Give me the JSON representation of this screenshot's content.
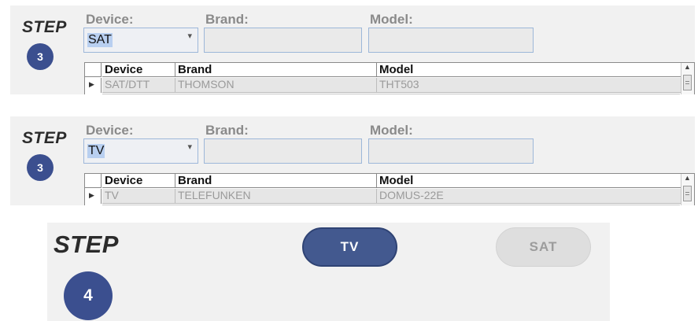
{
  "colors": {
    "step_circle": "#3b4f8f",
    "tv_button": "#43598f",
    "sat_button": "#dedede",
    "panel_bg": "#f1f1f1",
    "selection_highlight": "#b8cff0"
  },
  "panel_sat": {
    "step_word": "STEP",
    "step_number": "3",
    "device_label": "Device:",
    "brand_label": "Brand:",
    "model_label": "Model:",
    "device_value": "SAT",
    "brand_value": "",
    "model_value": "",
    "table": {
      "columns": [
        "Device",
        "Brand",
        "Model"
      ],
      "rows": [
        {
          "device": "SAT/DTT",
          "brand": "THOMSON",
          "model": "THT503"
        }
      ]
    }
  },
  "panel_tv": {
    "step_word": "STEP",
    "step_number": "3",
    "device_label": "Device:",
    "brand_label": "Brand:",
    "model_label": "Model:",
    "device_value": "TV",
    "brand_value": "",
    "model_value": "",
    "table": {
      "columns": [
        "Device",
        "Brand",
        "Model"
      ],
      "rows": [
        {
          "device": "TV",
          "brand": "TELEFUNKEN",
          "model": "DOMUS-22E"
        }
      ]
    }
  },
  "panel_step4": {
    "step_word": "STEP",
    "step_number": "4",
    "tv_button": "TV",
    "sat_button": "SAT"
  }
}
